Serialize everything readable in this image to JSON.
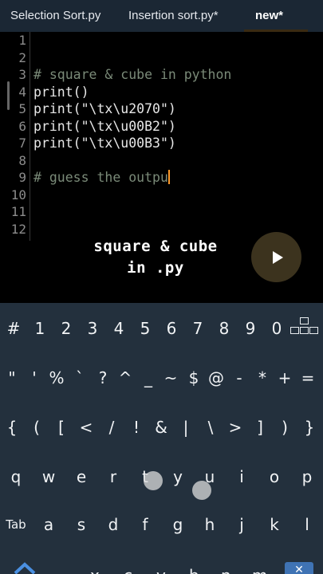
{
  "tabs": [
    {
      "label": "Selection Sort.py"
    },
    {
      "label": "Insertion sort.py*"
    },
    {
      "label": "new*"
    }
  ],
  "editor": {
    "line_numbers": [
      "1",
      "2",
      "3",
      "4",
      "5",
      "6",
      "7",
      "8",
      "9",
      "10",
      "11",
      "12"
    ],
    "lines": [
      {
        "n": 3,
        "text": "# square & cube in python",
        "type": "comment"
      },
      {
        "n": 4,
        "text": "print()",
        "type": "code"
      },
      {
        "n": 5,
        "text": "print(\"\\tx\\u2070\")",
        "type": "code"
      },
      {
        "n": 6,
        "text": "print(\"\\tx\\u00B2\")",
        "type": "code"
      },
      {
        "n": 7,
        "text": "print(\"\\tx\\u00B3\")",
        "type": "code"
      },
      {
        "n": 9,
        "text": "# guess the outpu",
        "type": "comment"
      }
    ]
  },
  "overlay": {
    "line1": "square & cube",
    "line2": "in .py"
  },
  "play_icon": "play-icon",
  "keyboard": {
    "rows": [
      [
        "#",
        "1",
        "2",
        "3",
        "4",
        "5",
        "6",
        "7",
        "8",
        "9",
        "0"
      ],
      [
        "\"",
        "'",
        "%",
        "`",
        "?",
        "^",
        "_",
        "~",
        "$",
        "@",
        "-",
        "*",
        "+",
        "="
      ],
      [
        "{",
        "(",
        "[",
        "<",
        "/",
        "!",
        "&",
        "|",
        "\\",
        ">",
        "]",
        ")",
        "}"
      ],
      [
        "q",
        "w",
        "e",
        "r",
        "t",
        "y",
        "u",
        "i",
        "o",
        "p"
      ],
      [
        "Tab",
        "a",
        "s",
        "d",
        "f",
        "g",
        "h",
        "j",
        "k",
        "l"
      ]
    ],
    "bottom_partial": [
      "z",
      "x",
      "c",
      "v",
      "b",
      "n",
      "m"
    ],
    "layout_icon": "keyboard-layout-icon",
    "shift_icon": "chevron-up-icon",
    "delete_icon": "backspace-icon"
  },
  "colors": {
    "tabbar_bg": "#1b2734",
    "keyboard_bg": "#23303d",
    "caret": "#ff9a2a",
    "comment": "#7a8a78"
  }
}
